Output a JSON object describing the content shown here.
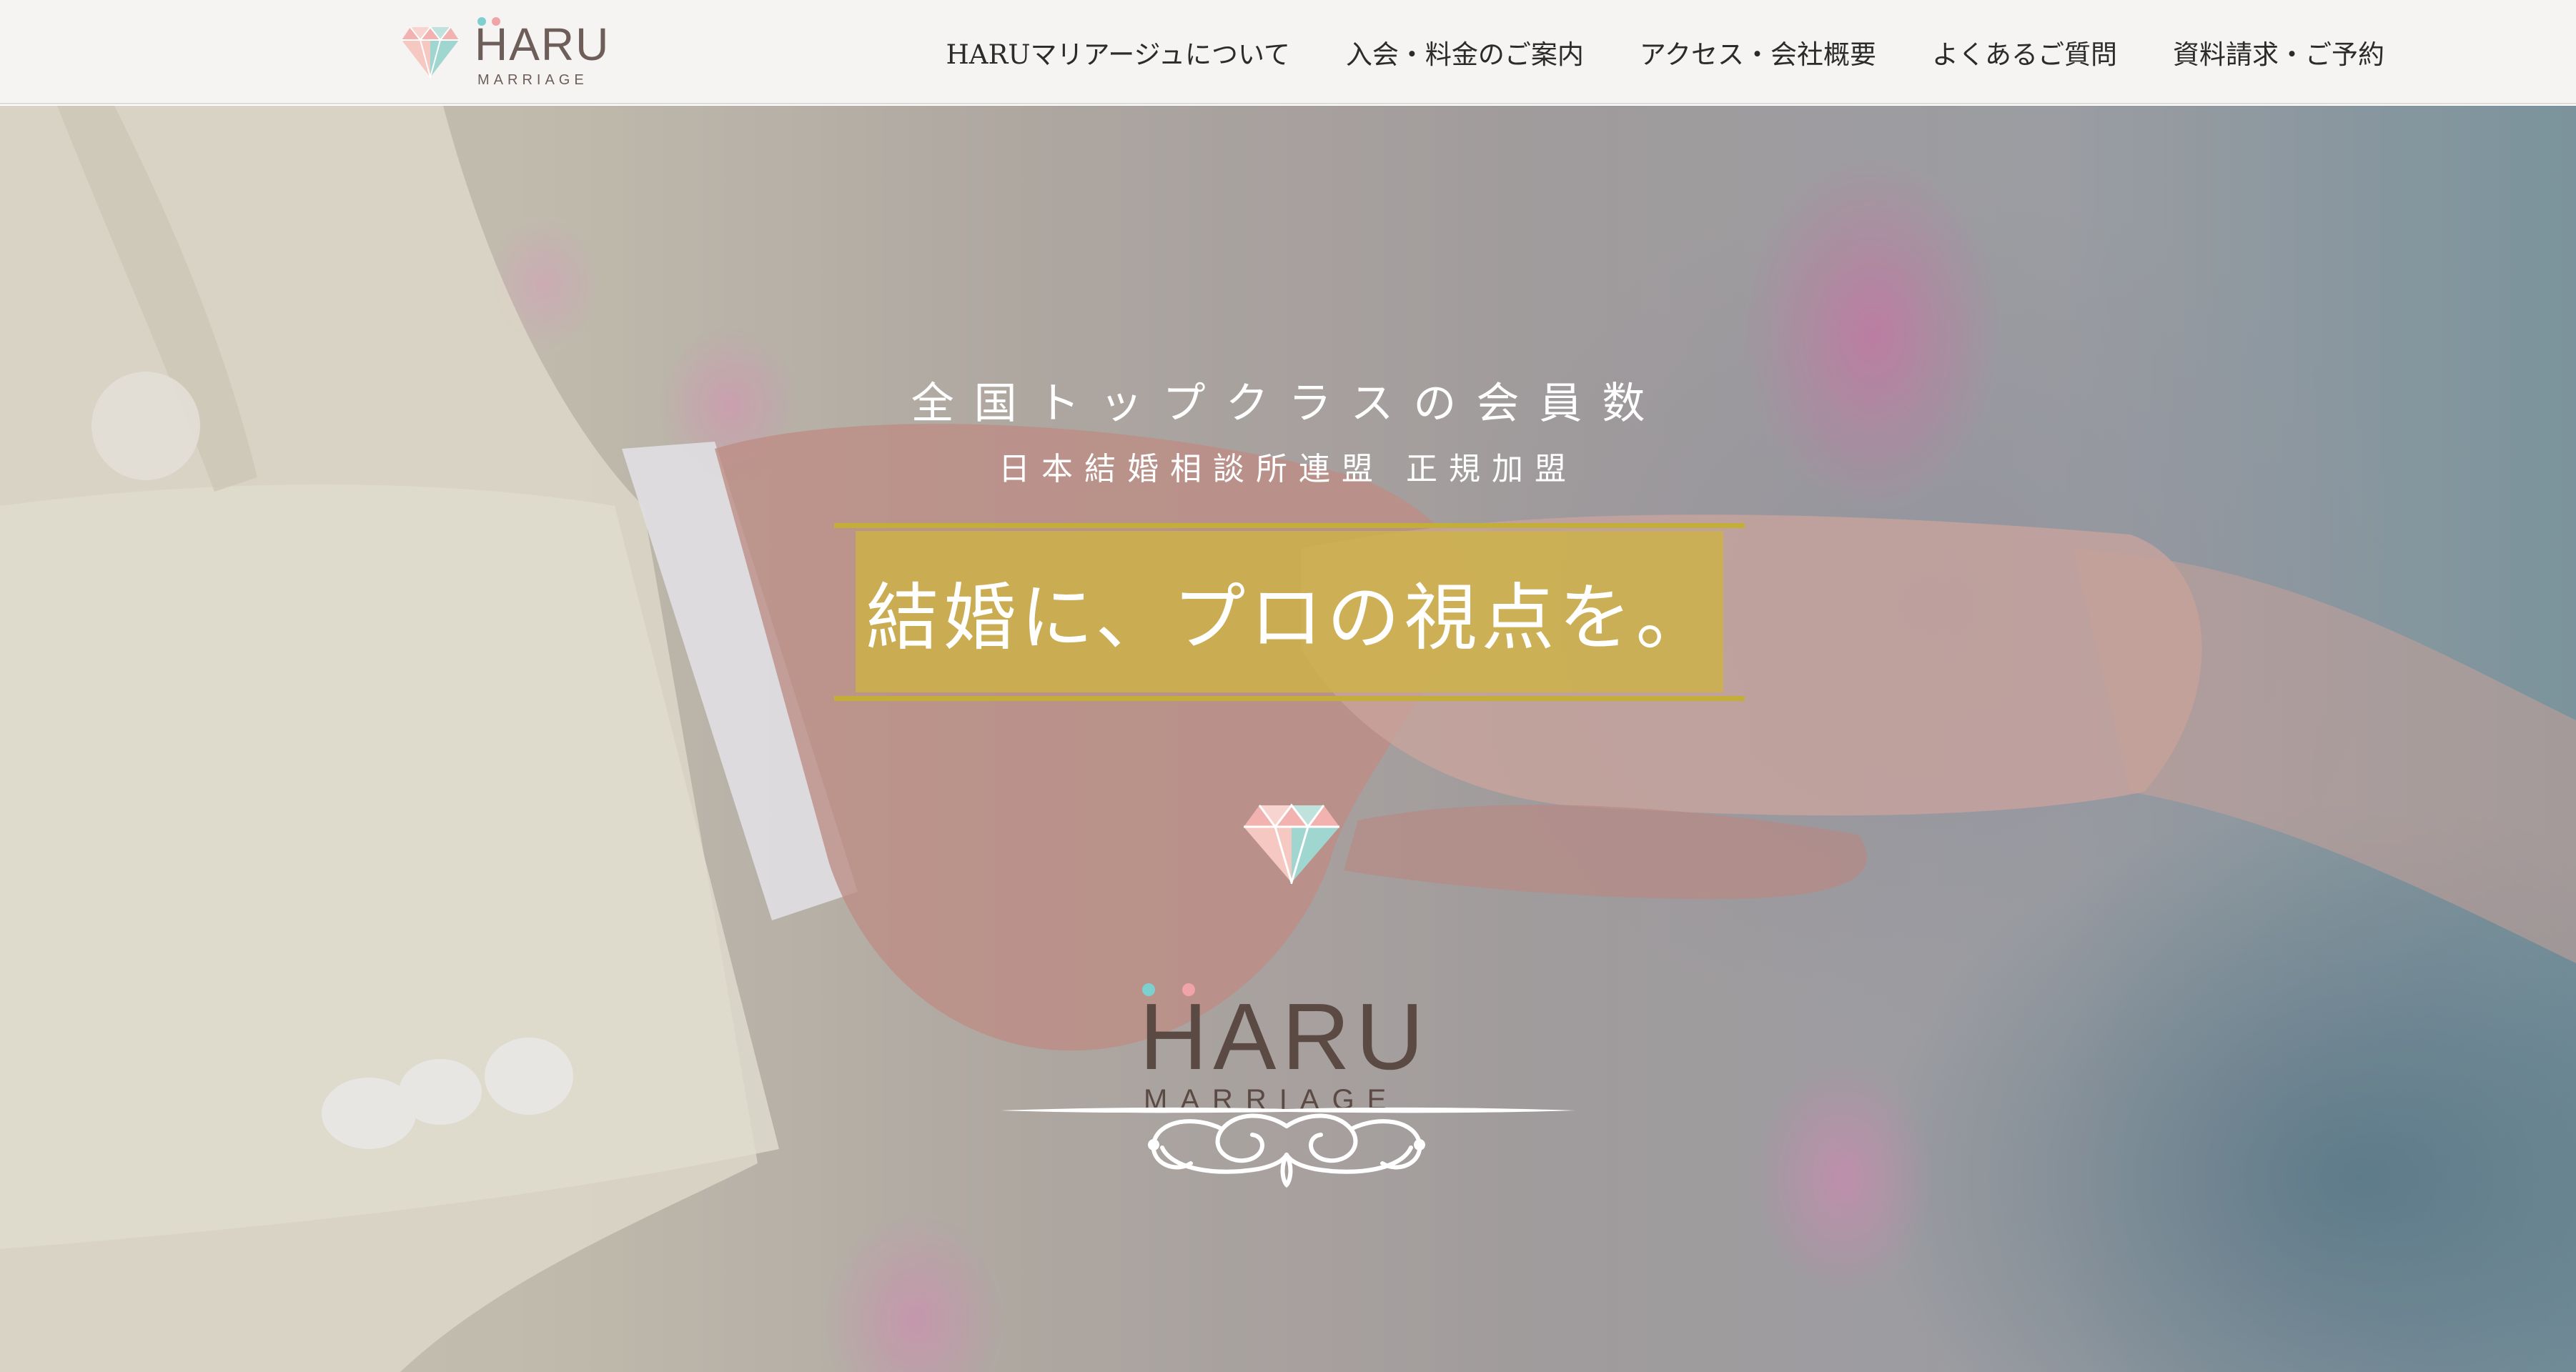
{
  "header": {
    "logo": {
      "word": "HARU",
      "sub": "MARRIAGE"
    },
    "nav": [
      {
        "label": "HARUマリアージュについて"
      },
      {
        "label": "入会・料金のご案内"
      },
      {
        "label": "アクセス・会社概要"
      },
      {
        "label": "よくあるご質問"
      },
      {
        "label": "資料請求・ご予約"
      }
    ]
  },
  "hero": {
    "tagline": "全国トップクラスの会員数",
    "sub_tagline": "日本結婚相談所連盟 正規加盟",
    "headline": "結婚に、プロの視点を。",
    "logo": {
      "word": "HARU",
      "sub": "MARRIAGE"
    }
  },
  "colors": {
    "banner_gold": "#c2ae38",
    "logo_brown": "#5b4944",
    "dot_teal": "#7ecfd0",
    "dot_pink": "#f0a4a8",
    "diamond_pink": "#f2b3b0",
    "diamond_teal": "#9fd6cf"
  },
  "icons": {
    "logo_mark": "diamond-icon",
    "ornament": "flourish-divider"
  }
}
